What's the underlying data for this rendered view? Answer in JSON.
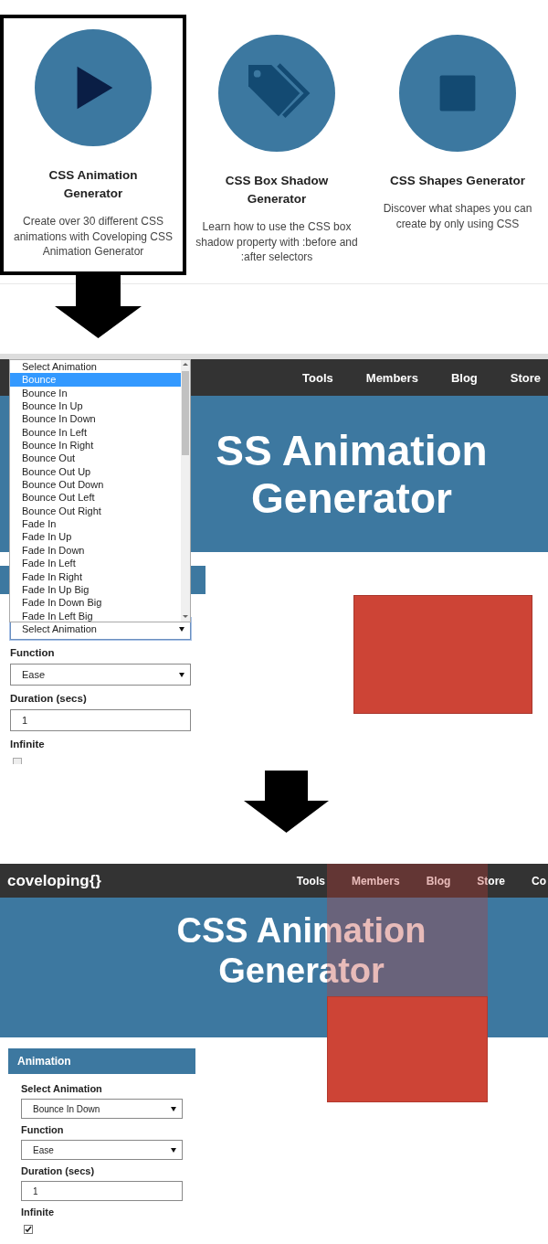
{
  "tool_cards": [
    {
      "title": "CSS Animation Generator",
      "description": "Create over 30 different CSS animations with Coveloping CSS Animation Generator",
      "kind": "play",
      "selected": true
    },
    {
      "title": "CSS Box Shadow Generator",
      "description": "Learn how to use the CSS box shadow property with :before and :after selectors",
      "kind": "tag",
      "selected": false
    },
    {
      "title": "CSS Shapes Generator",
      "description": "Discover what shapes you can create by only using CSS",
      "kind": "square",
      "selected": false
    }
  ],
  "dropdown_demo": {
    "nav": {
      "links": [
        "Tools",
        "Members",
        "Blog",
        "Store"
      ]
    },
    "hero_lines": [
      "SS Animation",
      "Generator"
    ],
    "options": [
      {
        "label": "Select Animation",
        "selected": false
      },
      {
        "label": "Bounce",
        "selected": true
      },
      {
        "label": "Bounce In",
        "selected": false
      },
      {
        "label": "Bounce In Up",
        "selected": false
      },
      {
        "label": "Bounce In Down",
        "selected": false
      },
      {
        "label": "Bounce In Left",
        "selected": false
      },
      {
        "label": "Bounce In Right",
        "selected": false
      },
      {
        "label": "Bounce Out",
        "selected": false
      },
      {
        "label": "Bounce Out Up",
        "selected": false
      },
      {
        "label": "Bounce Out Down",
        "selected": false
      },
      {
        "label": "Bounce Out Left",
        "selected": false
      },
      {
        "label": "Bounce Out Right",
        "selected": false
      },
      {
        "label": "Fade In",
        "selected": false
      },
      {
        "label": "Fade In Up",
        "selected": false
      },
      {
        "label": "Fade In Down",
        "selected": false
      },
      {
        "label": "Fade In Left",
        "selected": false
      },
      {
        "label": "Fade In Right",
        "selected": false
      },
      {
        "label": "Fade In Up Big",
        "selected": false
      },
      {
        "label": "Fade In Down Big",
        "selected": false
      },
      {
        "label": "Fade In Left Big",
        "selected": false
      }
    ],
    "fields": [
      {
        "kind": "select",
        "value": "Select Animation",
        "focused": true
      },
      {
        "kind": "select",
        "label": "Function",
        "value": "Ease",
        "focused": false
      },
      {
        "kind": "text",
        "label": "Duration (secs)",
        "value": "1",
        "focused": false
      },
      {
        "kind": "checkbox",
        "label": "Infinite",
        "checked": false
      }
    ]
  },
  "result_demo": {
    "nav": {
      "logo": "coveloping{}",
      "links": [
        "Tools",
        "Members",
        "Blog",
        "Store",
        "Co"
      ]
    },
    "hero_lines": [
      "CSS Animation",
      "Generator"
    ],
    "section_title": "Animation",
    "fields": [
      {
        "kind": "select",
        "label": "Select Animation",
        "value": "Bounce In Down",
        "focused": false
      },
      {
        "kind": "select",
        "label": "Function",
        "value": "Ease",
        "focused": false
      },
      {
        "kind": "text",
        "label": "Duration (secs)",
        "value": "1",
        "focused": false
      },
      {
        "kind": "checkbox",
        "label": "Infinite",
        "checked": true
      }
    ]
  }
}
